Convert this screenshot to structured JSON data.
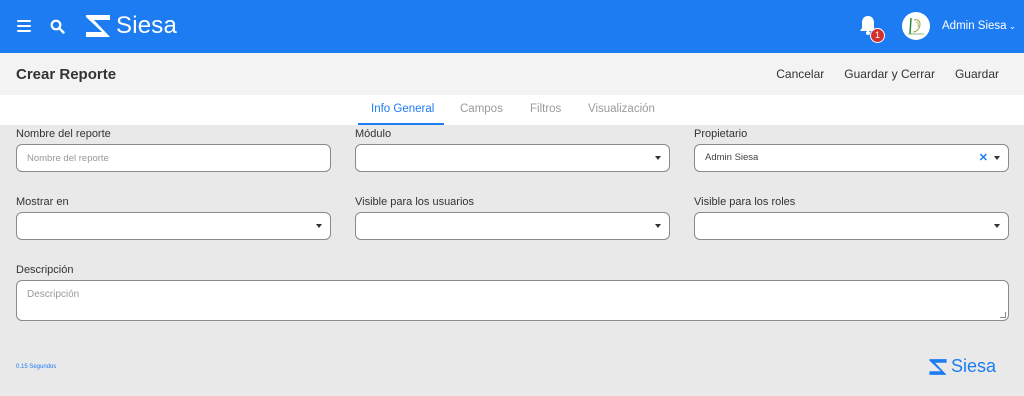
{
  "colors": {
    "brand": "#1d7cf2",
    "badge": "#d32f2f",
    "background": "#e9e9e9"
  },
  "topbar": {
    "logo_text": "Siesa",
    "menu_icon": "hamburger-menu-icon",
    "search_icon": "search-icon",
    "notifications": {
      "icon": "bell-icon",
      "count": "1"
    },
    "user": {
      "name": "Admin Siesa",
      "avatar_icon": "company-logo-avatar"
    }
  },
  "header": {
    "title": "Crear Reporte",
    "actions": {
      "cancel": "Cancelar",
      "save_close": "Guardar y Cerrar",
      "save": "Guardar"
    }
  },
  "tabs": [
    {
      "label": "Info General",
      "active": true
    },
    {
      "label": "Campos",
      "active": false
    },
    {
      "label": "Filtros",
      "active": false
    },
    {
      "label": "Visualización",
      "active": false
    }
  ],
  "form": {
    "report_name": {
      "label": "Nombre del reporte",
      "placeholder": "Nombre del reporte",
      "value": ""
    },
    "module": {
      "label": "Módulo",
      "value": ""
    },
    "owner": {
      "label": "Propietario",
      "value": "Admin Siesa"
    },
    "show_in": {
      "label": "Mostrar en",
      "value": ""
    },
    "visible_users": {
      "label": "Visible para los usuarios",
      "value": ""
    },
    "visible_roles": {
      "label": "Visible para los roles",
      "value": ""
    },
    "description": {
      "label": "Descripción",
      "placeholder": "Descripción",
      "value": ""
    }
  },
  "footer": {
    "timing": "0.15 Segundos",
    "logo_text": "Siesa"
  }
}
